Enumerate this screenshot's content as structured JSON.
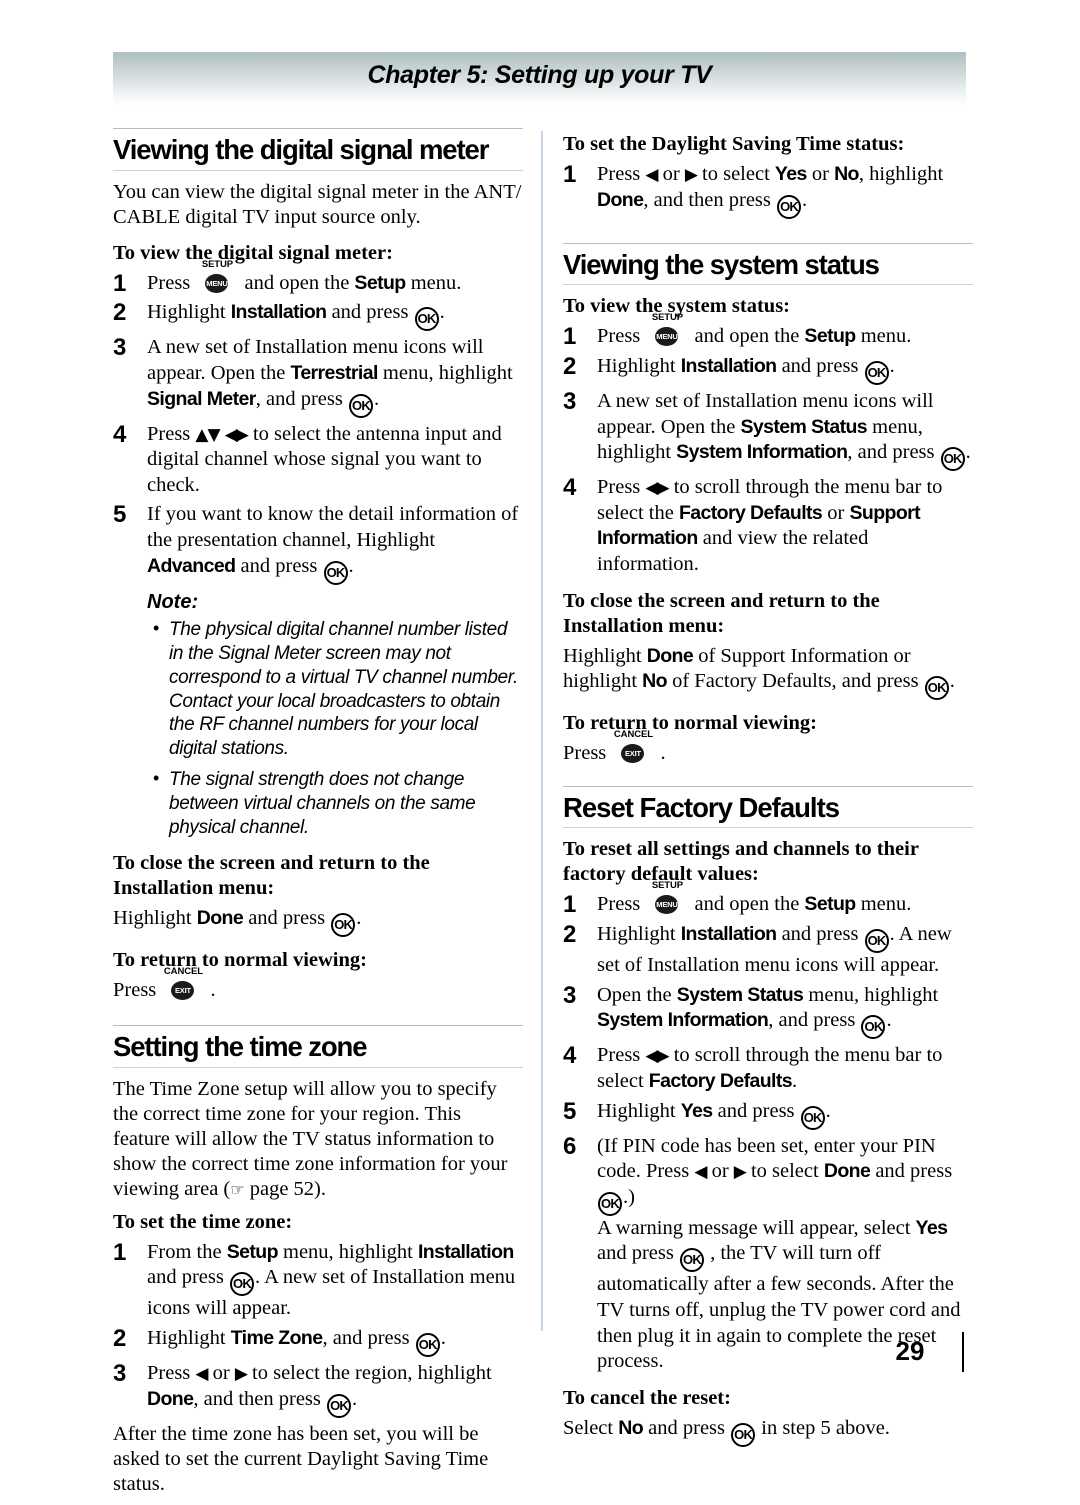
{
  "header": {
    "chapter_title": "Chapter 5: Setting up your TV"
  },
  "keys": {
    "ok": "OK",
    "setup_caption": "SETUP",
    "menu_label": "MENU",
    "cancel_caption": "CANCEL",
    "exit_label": "EXIT",
    "arrow_up": "▲",
    "arrow_down": "▼",
    "arrow_left": "◀",
    "arrow_right": "▶",
    "hand_pointer": "☞"
  },
  "left_column": {
    "section1": {
      "heading": "Viewing the digital signal meter",
      "intro": "You can view the digital signal meter in the ANT/ CABLE digital TV input source only.",
      "sub1": "To view the digital signal meter:",
      "steps": [
        {
          "num": "1",
          "parts": [
            "Press ",
            "[SETUP]",
            " and open the ",
            "Setup",
            " menu."
          ]
        },
        {
          "num": "2",
          "parts": [
            "Highlight ",
            "Installation",
            " and press ",
            "[OK]",
            "."
          ]
        },
        {
          "num": "3",
          "parts": [
            "A new set of Installation menu icons will appear. Open the ",
            "Terrestrial",
            " menu, highlight ",
            "Signal Meter",
            ", and press ",
            "[OK]",
            "."
          ]
        },
        {
          "num": "4",
          "parts": [
            "Press ",
            "[ARROWS]",
            " to select the antenna input and digital channel whose signal you want to check."
          ]
        },
        {
          "num": "5",
          "parts": [
            "If you want to know the detail information of the presentation channel, Highlight ",
            "Advanced",
            " and press ",
            "[OK]",
            "."
          ]
        }
      ],
      "note_heading": "Note:",
      "notes": [
        "The physical digital channel number listed in the Signal Meter screen may not correspond to a virtual TV channel number. Contact your local broadcasters to obtain the RF channel numbers for your local digital stations.",
        "The signal strength does not change between virtual channels on the same physical channel."
      ],
      "sub2": "To close the screen and return to the Installation menu:",
      "close_text": [
        "Highlight ",
        "Done",
        " and press ",
        "[OK]",
        "."
      ],
      "sub3": "To return to normal viewing:",
      "return_text": [
        "Press ",
        "[CANCEL]",
        " ."
      ]
    },
    "section2": {
      "heading": "Setting the time zone",
      "intro_a": "The Time Zone setup will allow you to specify the correct time zone for your region. This feature will allow the TV status information to show the correct time zone information for your viewing area (",
      "intro_page": " page 52).",
      "sub1": "To set the time zone:",
      "steps": [
        {
          "num": "1",
          "parts": [
            "From the ",
            "Setup",
            " menu, highlight ",
            "Installation",
            " and press ",
            "[OK]",
            ". A new set of Installation menu icons will appear."
          ]
        },
        {
          "num": "2",
          "parts": [
            "Highlight ",
            "Time Zone",
            ", and press ",
            "[OK]",
            "."
          ]
        },
        {
          "num": "3",
          "parts": [
            "Press ",
            "[LEFT]",
            " or ",
            "[RIGHT]",
            " to select the region, highlight ",
            "Done",
            ", and then press ",
            "[OK]",
            "."
          ]
        }
      ],
      "outro": "After the time zone has been set, you will be asked to set the current Daylight Saving Time status."
    }
  },
  "right_column": {
    "section1": {
      "sub1": "To set the Daylight Saving Time status:",
      "steps": [
        {
          "num": "1",
          "parts": [
            "Press ",
            "[LEFT]",
            " or ",
            "[RIGHT]",
            " to select ",
            "Yes",
            " or ",
            "No",
            ", highlight ",
            "Done",
            ", and then press ",
            "[OK]",
            "."
          ]
        }
      ]
    },
    "section2": {
      "heading": "Viewing the system status",
      "sub1": "To view the system status:",
      "steps": [
        {
          "num": "1",
          "parts": [
            "Press ",
            "[SETUP]",
            " and open the ",
            "Setup",
            " menu."
          ]
        },
        {
          "num": "2",
          "parts": [
            "Highlight ",
            "Installation",
            " and press ",
            "[OK]",
            "."
          ]
        },
        {
          "num": "3",
          "parts": [
            "A new set of Installation menu icons will appear. Open the ",
            "System Status",
            " menu, highlight ",
            "System Information",
            ", and press ",
            "[OK]",
            "."
          ]
        },
        {
          "num": "4",
          "parts": [
            "Press ",
            "[ARROWS_LR]",
            " to scroll through the menu bar to select the ",
            "Factory Defaults",
            " or ",
            "Support Information",
            " and view the related information."
          ]
        }
      ],
      "sub2": "To close the screen and return to the Installation menu:",
      "close_text": [
        "Highlight ",
        "Done",
        " of Support Information or highlight ",
        "No",
        " of Factory Defaults, and press ",
        "[OK]",
        "."
      ],
      "sub3": "To return to normal viewing:",
      "return_text": [
        "Press ",
        "[CANCEL]",
        " ."
      ]
    },
    "section3": {
      "heading": "Reset Factory Defaults",
      "sub1": "To reset all settings and channels to their factory default values:",
      "steps": [
        {
          "num": "1",
          "parts": [
            "Press ",
            "[SETUP]",
            " and open the ",
            "Setup",
            " menu."
          ]
        },
        {
          "num": "2",
          "parts": [
            "Highlight ",
            "Installation",
            " and press ",
            "[OK]",
            ". A new set of Installation menu icons will appear."
          ]
        },
        {
          "num": "3",
          "parts": [
            "Open the ",
            "System Status",
            " menu, highlight ",
            "System Information",
            ", and press ",
            "[OK]",
            "."
          ]
        },
        {
          "num": "4",
          "parts": [
            "Press ",
            "[ARROWS_LR]",
            " to scroll through the menu bar to select ",
            "Factory Defaults",
            "."
          ]
        },
        {
          "num": "5",
          "parts": [
            "Highlight ",
            "Yes",
            " and press ",
            "[OK]",
            "."
          ]
        },
        {
          "num": "6",
          "parts": [
            "(If PIN code has been set, enter your PIN code. Press ",
            "[LEFT]",
            " or ",
            "[RIGHT]",
            " to select ",
            "Done",
            " and press ",
            "[OK]",
            ".)"
          ]
        }
      ],
      "step6_continued": "A warning message will appear, select Yes and press OK , the TV will turn off automatically after a few seconds. After the TV turns off, unplug the TV power cord and then plug it in again to complete the reset process.",
      "sub2": "To cancel the reset:",
      "cancel_text": [
        "Select ",
        "No",
        " and press ",
        "[OK]",
        " in step 5 above."
      ]
    }
  },
  "footer": {
    "page_number": "29"
  }
}
